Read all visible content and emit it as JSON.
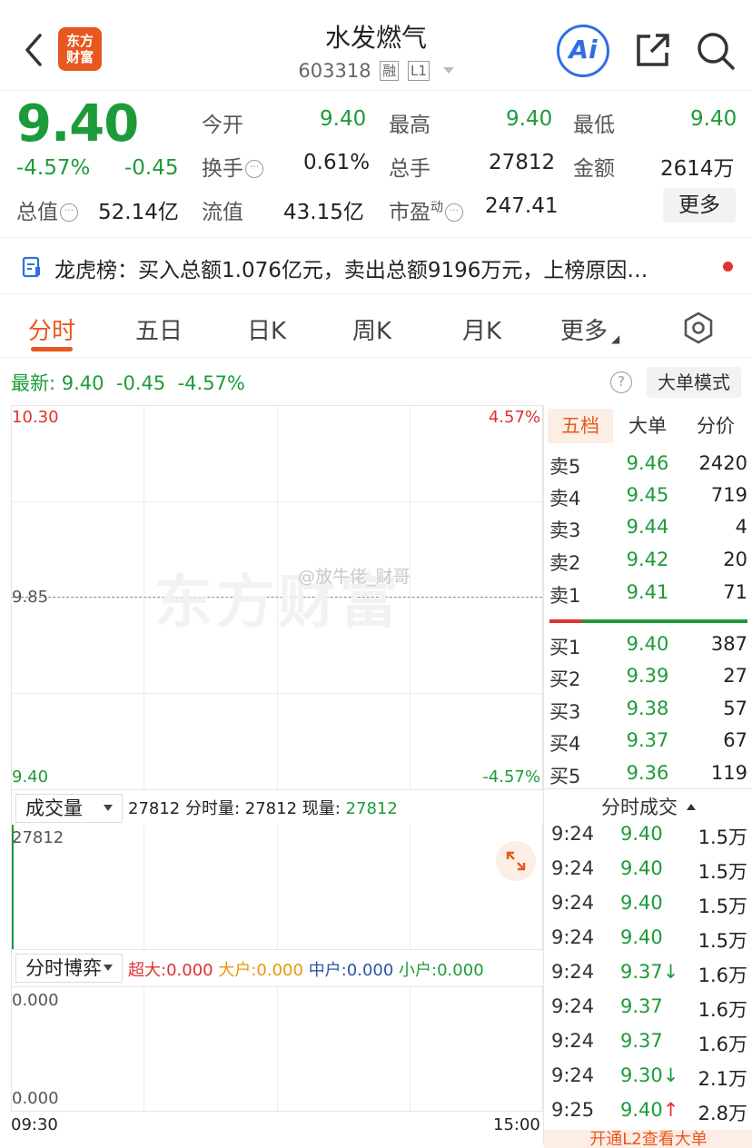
{
  "header": {
    "title": "水发燃气",
    "code": "603318",
    "tag_margin": "融",
    "tag_level": "L1",
    "logo_line1": "东方",
    "logo_line2": "财富",
    "ai_label": "Ai"
  },
  "quote": {
    "price": "9.40",
    "change_pct": "-4.57%",
    "change": "-0.45",
    "open_label": "今开",
    "open": "9.40",
    "high_label": "最高",
    "high": "9.40",
    "low_label": "最低",
    "low": "9.40",
    "turnover_label": "换手",
    "turnover": "0.61%",
    "volume_label": "总手",
    "volume": "27812",
    "amount_label": "金额",
    "amount": "2614万",
    "mktcap_label": "总值",
    "mktcap": "52.14亿",
    "float_label": "流值",
    "float_cap": "43.15亿",
    "pe_label": "市盈",
    "pe_sup": "动",
    "pe": "247.41",
    "more_label": "更多"
  },
  "banner": {
    "text": "龙虎榜：买入总额1.076亿元，卖出总额9196万元，上榜原因…"
  },
  "tabs": [
    {
      "label": "分时"
    },
    {
      "label": "五日"
    },
    {
      "label": "日K"
    },
    {
      "label": "周K"
    },
    {
      "label": "月K"
    },
    {
      "label": "更多"
    }
  ],
  "latest": {
    "label": "最新:",
    "price": "9.40",
    "change": "-0.45",
    "pct": "-4.57%",
    "help": "?",
    "mode_label": "大单模式"
  },
  "chart": {
    "y_top": "10.30",
    "y_mid": "9.85",
    "y_bottom": "9.40",
    "pct_top": "4.57%",
    "pct_bottom": "-4.57%",
    "watermark": "东方财富",
    "weibo": "@放牛佬_财哥"
  },
  "volume": {
    "select_label": "成交量",
    "info_prefix": "27812 分时量: 27812 现量: ",
    "current": "27812",
    "y_top": "27812"
  },
  "game": {
    "select_label": "分时博弈",
    "super_label": "超大:",
    "super_value": "0.000",
    "large_label": "大户:",
    "large_value": "0.000",
    "mid_label": "中户:",
    "mid_value": "0.000",
    "small_label": "小户:",
    "small_value": "0.000",
    "y_top": "0.000",
    "y_bottom": "0.000"
  },
  "time_axis": {
    "start": "09:30",
    "end": "15:00"
  },
  "orderbook": {
    "tabs": [
      {
        "label": "五档"
      },
      {
        "label": "大单"
      },
      {
        "label": "分价"
      }
    ],
    "asks": [
      {
        "name": "卖5",
        "price": "9.46",
        "vol": "2420"
      },
      {
        "name": "卖4",
        "price": "9.45",
        "vol": "719"
      },
      {
        "name": "卖3",
        "price": "9.44",
        "vol": "4"
      },
      {
        "name": "卖2",
        "price": "9.42",
        "vol": "20"
      },
      {
        "name": "卖1",
        "price": "9.41",
        "vol": "71"
      }
    ],
    "bids": [
      {
        "name": "买1",
        "price": "9.40",
        "vol": "387"
      },
      {
        "name": "买2",
        "price": "9.39",
        "vol": "27"
      },
      {
        "name": "买3",
        "price": "9.38",
        "vol": "57"
      },
      {
        "name": "买4",
        "price": "9.37",
        "vol": "67"
      },
      {
        "name": "买5",
        "price": "9.36",
        "vol": "119"
      }
    ],
    "ticks_header": "分时成交",
    "ticks": [
      {
        "time": "9:24",
        "price": "9.40",
        "vol": "1.5万"
      },
      {
        "time": "9:24",
        "price": "9.40",
        "vol": "1.5万"
      },
      {
        "time": "9:24",
        "price": "9.40",
        "vol": "1.5万"
      },
      {
        "time": "9:24",
        "price": "9.40",
        "vol": "1.5万"
      },
      {
        "time": "9:24",
        "price": "9.37↓",
        "vol": "1.6万"
      },
      {
        "time": "9:24",
        "price": "9.37",
        "vol": "1.6万"
      },
      {
        "time": "9:24",
        "price": "9.37",
        "vol": "1.6万"
      },
      {
        "time": "9:24",
        "price": "9.30↓",
        "vol": "2.1万"
      },
      {
        "time": "9:25",
        "price": "9.40↑",
        "vol": "2.8万"
      }
    ],
    "promo": "开通L2查看大单"
  },
  "colors": {
    "down": "#1d9b3a",
    "up": "#e03131",
    "accent": "#e8581e",
    "ai": "#2f6fe0"
  }
}
